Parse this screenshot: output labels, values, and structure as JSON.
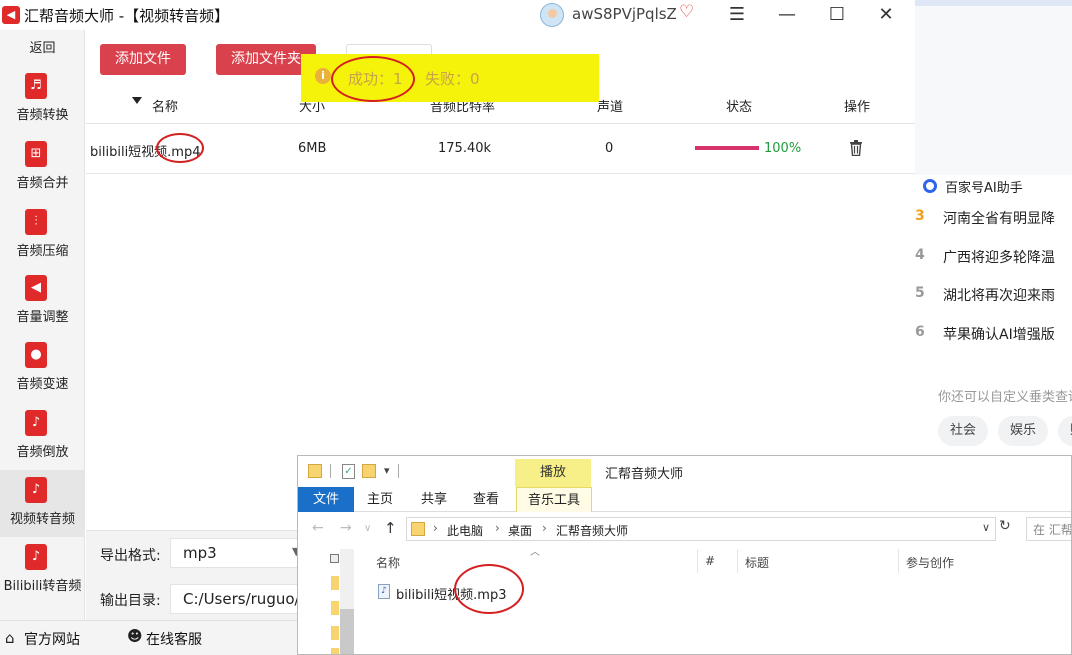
{
  "app": {
    "title": "汇帮音频大师  -【视频转音频】",
    "logo_icon": "speaker-icon",
    "user_name": "awS8PVjPqlsZ",
    "window_controls": {
      "menu": "☰",
      "minimize": "—",
      "maximize": "☐",
      "close": "✕"
    }
  },
  "sidebar": {
    "back_label": "返回",
    "items": [
      {
        "label": "音频转换",
        "icon": "audio-convert-icon",
        "glyph": "♬"
      },
      {
        "label": "音频合并",
        "icon": "audio-merge-icon",
        "glyph": "⊞"
      },
      {
        "label": "音频压缩",
        "icon": "audio-compress-icon",
        "glyph": "⫶"
      },
      {
        "label": "音量调整",
        "icon": "volume-icon",
        "glyph": "◀"
      },
      {
        "label": "音频变速",
        "icon": "speed-icon",
        "glyph": "●"
      },
      {
        "label": "音频倒放",
        "icon": "reverse-icon",
        "glyph": "♪"
      },
      {
        "label": "视频转音频",
        "icon": "video-to-audio-icon",
        "glyph": "♪",
        "active": true
      },
      {
        "label": "Bilibili转音频",
        "icon": "bilibili-icon",
        "glyph": "♪"
      }
    ]
  },
  "toolbar": {
    "add_file_label": "添加文件",
    "add_folder_label": "添加文件夹"
  },
  "toast": {
    "success_text": "成功：1",
    "fail_text": "失败：0"
  },
  "table": {
    "headers": {
      "name": "名称",
      "size": "大小",
      "bitrate": "音频比特率",
      "channel": "声道",
      "status": "状态",
      "action": "操作"
    },
    "rows": [
      {
        "name": "bilibili短视频.mp4",
        "size": "6MB",
        "bitrate": "175.40k",
        "channel": "0",
        "progress_percent": 100,
        "progress_text": "100%"
      }
    ]
  },
  "settings": {
    "export_format_label": "导出格式:",
    "export_format_value": "mp3",
    "output_dir_label": "输出目录:",
    "output_dir_value": "C:/Users/ruguo/D"
  },
  "footer": {
    "site_label": "官方网站",
    "service_label": "在线客服"
  },
  "browser": {
    "ai_label": "百家号AI助手",
    "news": [
      {
        "num": "3",
        "text": "河南全省有明显降",
        "color": "#f0a020"
      },
      {
        "num": "4",
        "text": "广西将迎多轮降温",
        "color": "#999999"
      },
      {
        "num": "5",
        "text": "湖北将再次迎来雨",
        "color": "#999999"
      },
      {
        "num": "6",
        "text": "苹果确认AI增强版",
        "color": "#999999"
      }
    ],
    "custom_hint": "你还可以自定义垂类查询",
    "chips": [
      "社会",
      "娱乐",
      "财"
    ]
  },
  "explorer": {
    "title": "汇帮音频大师",
    "play_tab": "播放",
    "ribbon_tabs": {
      "file": "文件",
      "home": "主页",
      "share": "共享",
      "view": "查看",
      "music_tools": "音乐工具"
    },
    "breadcrumbs": [
      "此电脑",
      "桌面",
      "汇帮音频大师"
    ],
    "search_placeholder": "在 汇帮",
    "columns": {
      "name": "名称",
      "number": "#",
      "title": "标题",
      "artist": "参与创作"
    },
    "files": [
      {
        "name": "bilibili短视频.mp3"
      }
    ]
  },
  "colors": {
    "accent_red": "#d9424c",
    "toast_yellow": "#f5f30a",
    "progress_pink": "#d6336c",
    "success_green": "#1f9d3a",
    "annotation_red": "#d42020",
    "explorer_blue": "#1a6fc9"
  }
}
